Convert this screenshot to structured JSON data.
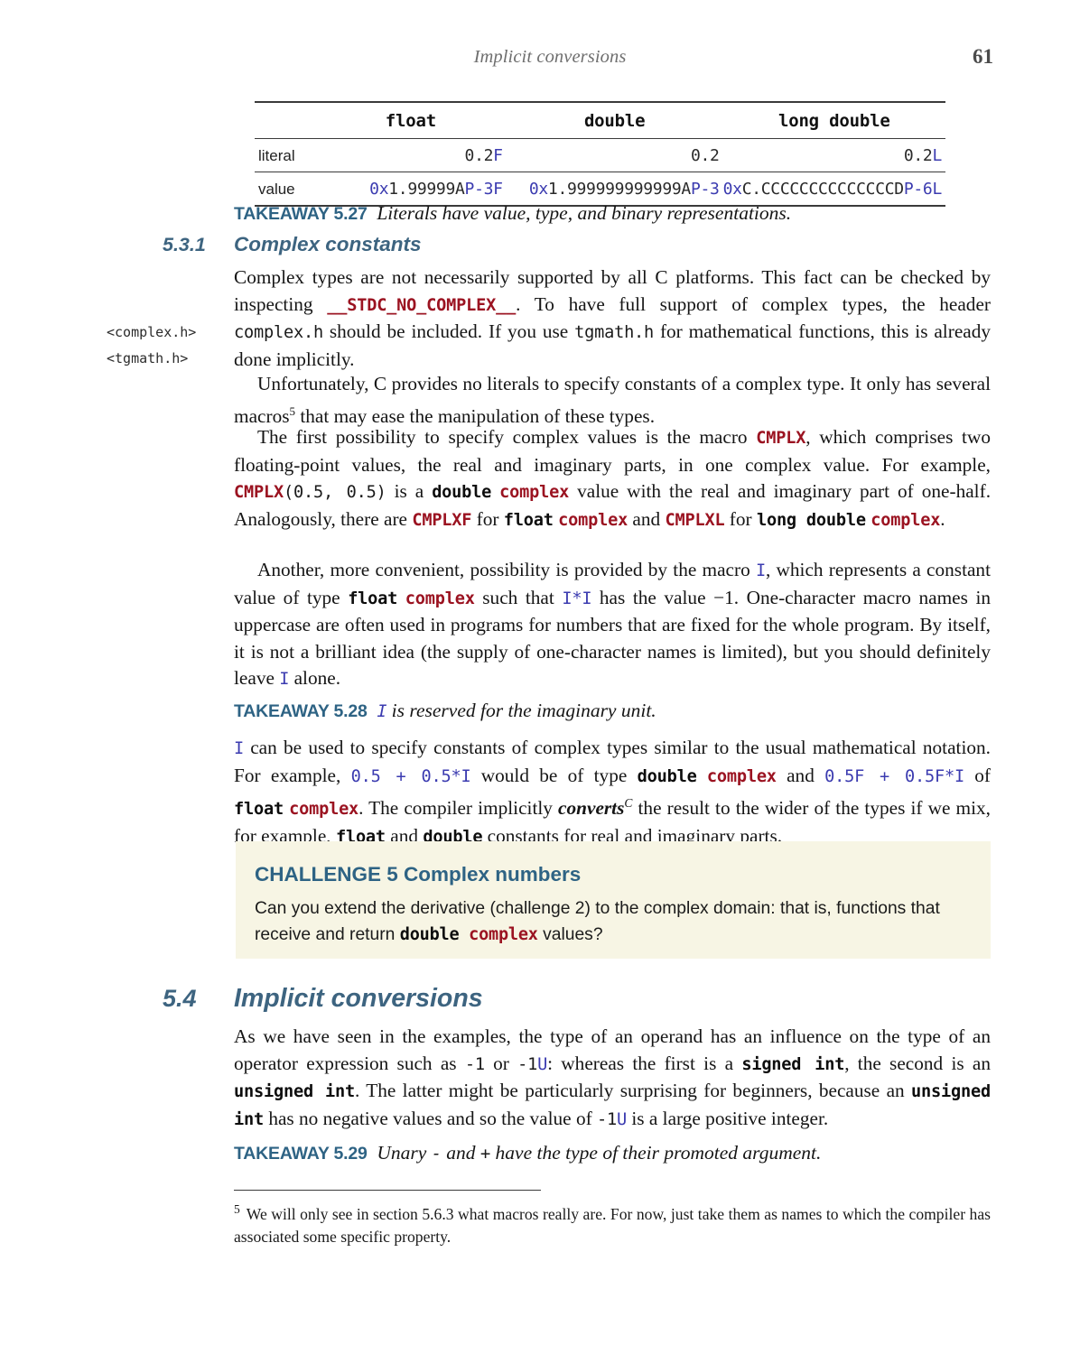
{
  "header": {
    "running_title": "Implicit conversions",
    "page_number": "61"
  },
  "table": {
    "columns": [
      "",
      "float",
      "double",
      "long double"
    ],
    "rows": [
      {
        "label": "literal",
        "float": {
          "base": "0.2",
          "suffix": "F"
        },
        "double": {
          "base": "0.2",
          "suffix": ""
        },
        "long_double": {
          "base": "0.2",
          "suffix": "L"
        }
      },
      {
        "label": "value",
        "float": {
          "prefix": "0x",
          "mantissa": "1.99999A",
          "exp": "P-3",
          "suffix": "F"
        },
        "double": {
          "prefix": "0x",
          "mantissa": "1.999999999999A",
          "exp": "P-3",
          "suffix": ""
        },
        "long_double": {
          "prefix": "0x",
          "mantissa": "C.CCCCCCCCCCCCCCD",
          "exp": "P-6",
          "suffix": "L"
        }
      }
    ]
  },
  "takeaways": [
    {
      "label": "TAKEAWAY 5.27",
      "text": "Literals have value, type, and binary representations."
    },
    {
      "label": "TAKEAWAY 5.28",
      "code": "I",
      "text": "is reserved for the imaginary unit."
    },
    {
      "label": "TAKEAWAY 5.29",
      "text_pre": "Unary",
      "minus": "-",
      "and": "and",
      "plus": "+",
      "text_post": "have the type of their promoted argument."
    }
  ],
  "section_531": {
    "number": "5.3.1",
    "title": "Complex constants",
    "margin_notes": [
      "<complex.h>",
      "<tgmath.h>"
    ],
    "para1": {
      "s1": "Complex types are not necessarily supported by all C platforms. This fact can be checked by inspecting",
      "macro": "__STDC_NO_COMPLEX__",
      "s2": ". To have full support of complex types, the header",
      "hdr1": "complex.h",
      "s3": "should be included. If you use",
      "hdr2": "tgmath.h",
      "s4": "for mathematical functions, this is already done implicitly."
    },
    "para2": {
      "s1": "Unfortunately, C provides no literals to specify constants of a complex type. It only has several macros",
      "footnote_mark": "5",
      "s2": "that may ease the manipulation of these types."
    },
    "para3": {
      "s1": "The first possibility to specify complex values is the macro",
      "cmplx": "CMPLX",
      "s2": ", which comprises two floating-point values, the real and imaginary parts, in one complex value. For example,",
      "cmplx2": "CMPLX",
      "args": "(0.5,  0.5)",
      "s3": "is a",
      "t_double": "double",
      "t_complex": "complex",
      "s4": "value with the real and imaginary part of one-half. Analogously, there are",
      "cmplxf": "CMPLXF",
      "s5": "for",
      "t_float": "float",
      "t_complex2": "complex",
      "s6": "and",
      "cmplxl": "CMPLXL",
      "s7": "for",
      "t_long": "long double",
      "t_complex3": "complex",
      "s8": "."
    },
    "para4": {
      "s1": "Another, more convenient, possibility is provided by the macro",
      "i1": "I",
      "s2": ", which represents a constant value of type",
      "t_float": "float",
      "t_complex": "complex",
      "s3": "such that",
      "i_mul_i": "I*I",
      "s4": "has the value −1. One-character macro names in uppercase are often used in programs for numbers that are fixed for the whole program. By itself, it is not a brilliant idea (the supply of one-character names is limited), but you should definitely leave",
      "i2": "I",
      "s5": "alone."
    },
    "para5": {
      "i1": "I",
      "s1": "can be used to specify constants of complex types similar to the usual mathematical notation. For example,",
      "expr1": "0.5 + 0.5*I",
      "s2": "would be of type",
      "t_double": "double",
      "t_complex": "complex",
      "s3": "and",
      "expr2": "0.5F + 0.5F*I",
      "s4": "of",
      "t_float": "float",
      "t_complex2": "complex",
      "s5": ". The compiler implicitly",
      "converts": "converts",
      "converts_sup": "C",
      "s6": "the result to the wider of the types if we mix, for example,",
      "t_float2": "float",
      "s7": "and",
      "t_double2": "double",
      "s8": "constants for real and imaginary parts."
    }
  },
  "challenge": {
    "title": "CHALLENGE 5 Complex numbers",
    "body_1": "Can you extend the derivative (challenge 2) to the complex domain: that is, functions that receive and return",
    "code_double": "double",
    "code_complex": "complex",
    "body_2": "values?"
  },
  "section_54": {
    "number": "5.4",
    "title": "Implicit conversions",
    "para1": {
      "s1": "As we have seen in the examples, the type of an operand has an influence on the type of an operator expression such as",
      "c1": "-1",
      "s2": "or",
      "c2_base": "-1",
      "c2_suffix": "U",
      "s3": ": whereas the first is a",
      "t_signed": "signed int",
      "s4": ", the second is an",
      "t_unsigned": "unsigned int",
      "s5": ". The latter might be particularly surprising for beginners, because an",
      "t_unsigned2": "unsigned int",
      "s6": "has no negative values and so the value of",
      "c3_base": "-1",
      "c3_suffix": "U",
      "s7": "is a large positive integer."
    }
  },
  "footnote": {
    "marker": "5",
    "text": "We will only see in section 5.6.3 what macros really are. For now, just take them as names to which the compiler has associated some specific property."
  },
  "colors": {
    "heading": "#3d6480",
    "takeaway_label": "#2e6384",
    "macro_red": "#9b1321",
    "literal_blue": "#3b3bb0",
    "challenge_bg": "#f7f5e4"
  }
}
